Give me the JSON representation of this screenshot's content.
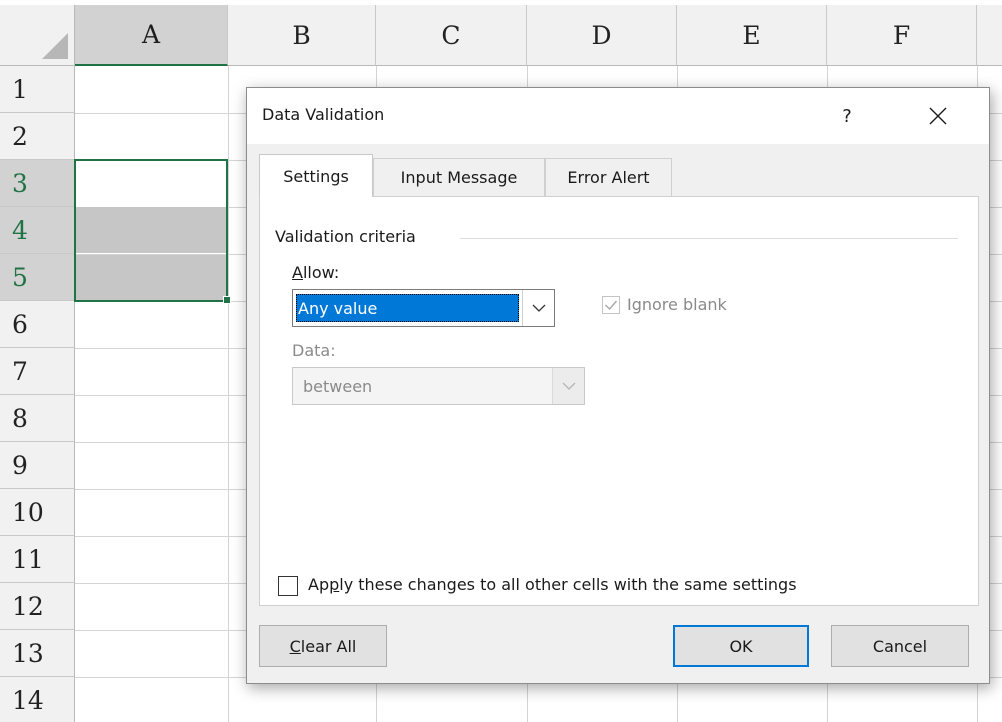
{
  "spreadsheet": {
    "columns": [
      "A",
      "B",
      "C",
      "D",
      "E",
      "F"
    ],
    "selected_column": "A",
    "rows": [
      "1",
      "2",
      "3",
      "4",
      "5",
      "6",
      "7",
      "8",
      "9",
      "10",
      "11",
      "12",
      "13",
      "14"
    ],
    "selected_rows": [
      "3",
      "4",
      "5"
    ],
    "selection_range": "A3:A5",
    "accent_color": "#217346"
  },
  "dialog": {
    "title": "Data Validation",
    "help_glyph": "?",
    "tabs": [
      {
        "label": "Settings",
        "active": true
      },
      {
        "label": "Input Message",
        "active": false
      },
      {
        "label": "Error Alert",
        "active": false
      }
    ],
    "criteria_section_label": "Validation criteria",
    "allow": {
      "label_accel": "A",
      "label_rest": "llow:",
      "value": "Any value"
    },
    "ignore_blank": {
      "label": "Ignore blank",
      "checked": true,
      "enabled": false
    },
    "data": {
      "label": "Data:",
      "value": "between",
      "enabled": false
    },
    "apply_all": {
      "label_pre": "Ap",
      "label_accel": "p",
      "label_post": "ly these changes to all other cells with the same settings",
      "checked": false
    },
    "buttons": {
      "clear_accel": "C",
      "clear_rest": "lear All",
      "ok": "OK",
      "cancel": "Cancel"
    },
    "highlight_color": "#0078d7"
  }
}
